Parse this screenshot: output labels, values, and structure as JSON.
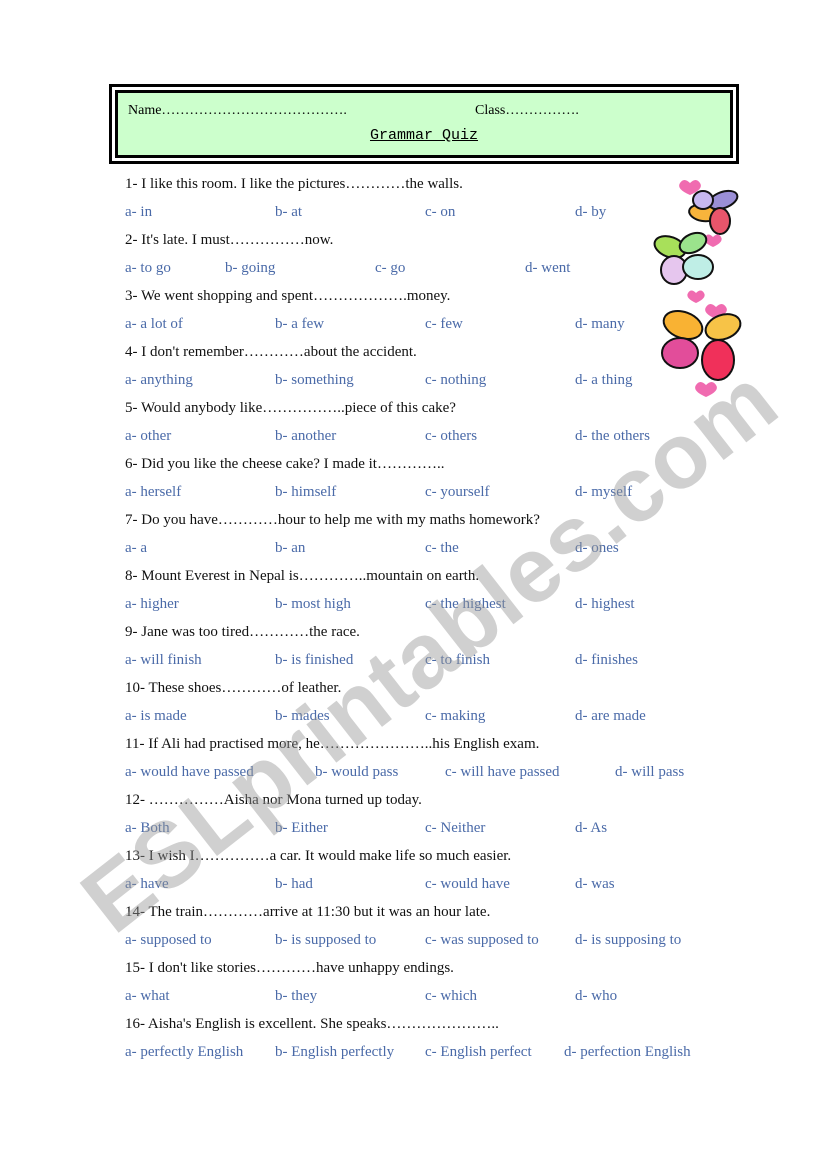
{
  "header": {
    "name_label": "Name………………………………….",
    "class_label": "Class…………….",
    "title": "Grammar Quiz"
  },
  "watermark": "ESLprintables.com",
  "colors": {
    "header_bg": "#ccffcc",
    "option_text": "#4a6aa8",
    "question_text": "#111111"
  },
  "questions": [
    {
      "text": "1- I like this room. I like the pictures…………the walls.",
      "options": [
        "a- in",
        "b- at",
        "c- on",
        "d- by"
      ]
    },
    {
      "text": "2- It's late. I must……………now.",
      "options": [
        "a- to go",
        "b- going",
        "c- go",
        "d- went"
      ]
    },
    {
      "text": "3- We went shopping and spent……………….money.",
      "options": [
        "a- a lot of",
        "b- a few",
        "c- few",
        "d- many"
      ]
    },
    {
      "text": "4- I don't remember…………about the accident.",
      "options": [
        "a- anything",
        "b- something",
        "c- nothing",
        "d- a thing"
      ]
    },
    {
      "text": "5- Would anybody like……………..piece of this cake?",
      "options": [
        "a- other",
        "b- another",
        "c- others",
        "d- the others"
      ]
    },
    {
      "text": "6- Did you like the cheese cake? I made it…………..",
      "options": [
        "a- herself",
        "b- himself",
        "c- yourself",
        "d- myself"
      ]
    },
    {
      "text": "7- Do you have…………hour to help me with my maths homework?",
      "options": [
        "a- a",
        "b- an",
        "c- the",
        "d- ones"
      ]
    },
    {
      "text": "8- Mount Everest in Nepal is…………..mountain on earth.",
      "options": [
        "a- higher",
        "b- most high",
        "c- the highest",
        "d- highest"
      ]
    },
    {
      "text": "9- Jane was too tired…………the race.",
      "options": [
        "a- will finish",
        "b- is finished",
        "c- to finish",
        "d- finishes"
      ]
    },
    {
      "text": "10- These shoes…………of leather.",
      "options": [
        "a- is made",
        "b- mades",
        "c- making",
        "d- are made"
      ]
    },
    {
      "text": "11- If Ali had practised more, he…………………..his English exam.",
      "options": [
        "a- would have passed",
        "b- would pass",
        "c- will have passed",
        "d- will pass"
      ]
    },
    {
      "text": "12- ……………Aisha nor Mona turned up today.",
      "options": [
        "a- Both",
        "b- Either",
        "c- Neither",
        "d- As"
      ]
    },
    {
      "text": "13- I wish I……………a car. It would make life so much easier.",
      "options": [
        "a- have",
        "b- had",
        "c- would have",
        "d- was"
      ]
    },
    {
      "text": "14- The train…………arrive at 11:30 but it was an hour late.",
      "options": [
        "a- supposed to",
        "b- is supposed to",
        "c- was supposed to",
        "d- is supposing to"
      ]
    },
    {
      "text": "15- I don't like stories…………have unhappy endings.",
      "options": [
        "a- what",
        "b- they",
        "c- which",
        "d- who"
      ]
    },
    {
      "text": "16-  Aisha's English is excellent. She speaks…………………..",
      "options": [
        "a- perfectly English",
        "b- English perfectly",
        "c- English perfect",
        "d- perfection English"
      ]
    }
  ]
}
